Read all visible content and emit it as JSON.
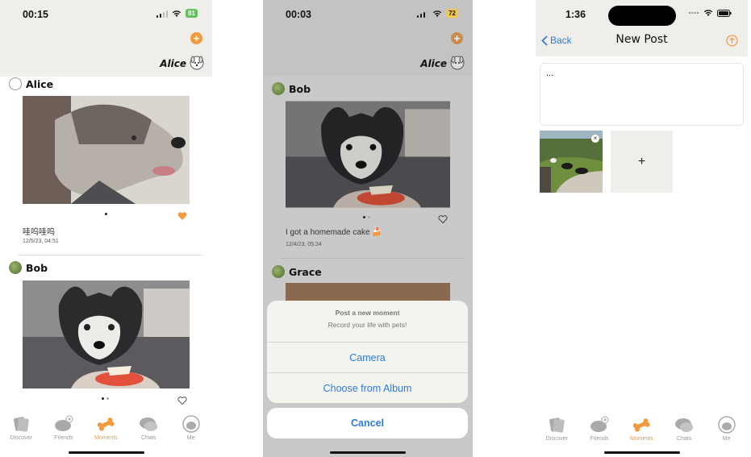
{
  "colors": {
    "accent": "#f29a3c",
    "link": "#2f7bd8",
    "header_bg": "#efeeeb"
  },
  "tabs": [
    {
      "label": "Discover",
      "icon": "cards-icon"
    },
    {
      "label": "Friends",
      "icon": "dog-add-icon"
    },
    {
      "label": "Moments",
      "icon": "bone-icon"
    },
    {
      "label": "Chats",
      "icon": "chat-bubbles-icon"
    },
    {
      "label": "Me",
      "icon": "dog-avatar-icon"
    }
  ],
  "screen1": {
    "time": "00:15",
    "battery": "81",
    "header_name": "Alice",
    "posts": [
      {
        "author": "Alice",
        "caption": "哇呜哇呜",
        "timestamp": "12/5/23, 04:51",
        "liked": true
      },
      {
        "author": "Bob",
        "liked": false
      }
    ],
    "active_tab": "Moments"
  },
  "screen2": {
    "time": "00:03",
    "battery": "72",
    "header_name": "Alice",
    "posts": [
      {
        "author": "Bob",
        "caption": "I got a homemade cake 🍰",
        "timestamp": "12/4/23, 05:34"
      },
      {
        "author": "Grace"
      }
    ],
    "sheet": {
      "title": "Post a new moment",
      "subtitle": "Record your life with pets!",
      "option1": "Camera",
      "option2": "Choose from Album",
      "cancel": "Cancel"
    }
  },
  "screen3": {
    "time": "1:36",
    "back_label": "Back",
    "title": "New Post",
    "text_value": "...",
    "add_label": "+",
    "remove_label": "×",
    "active_tab": "Moments"
  }
}
